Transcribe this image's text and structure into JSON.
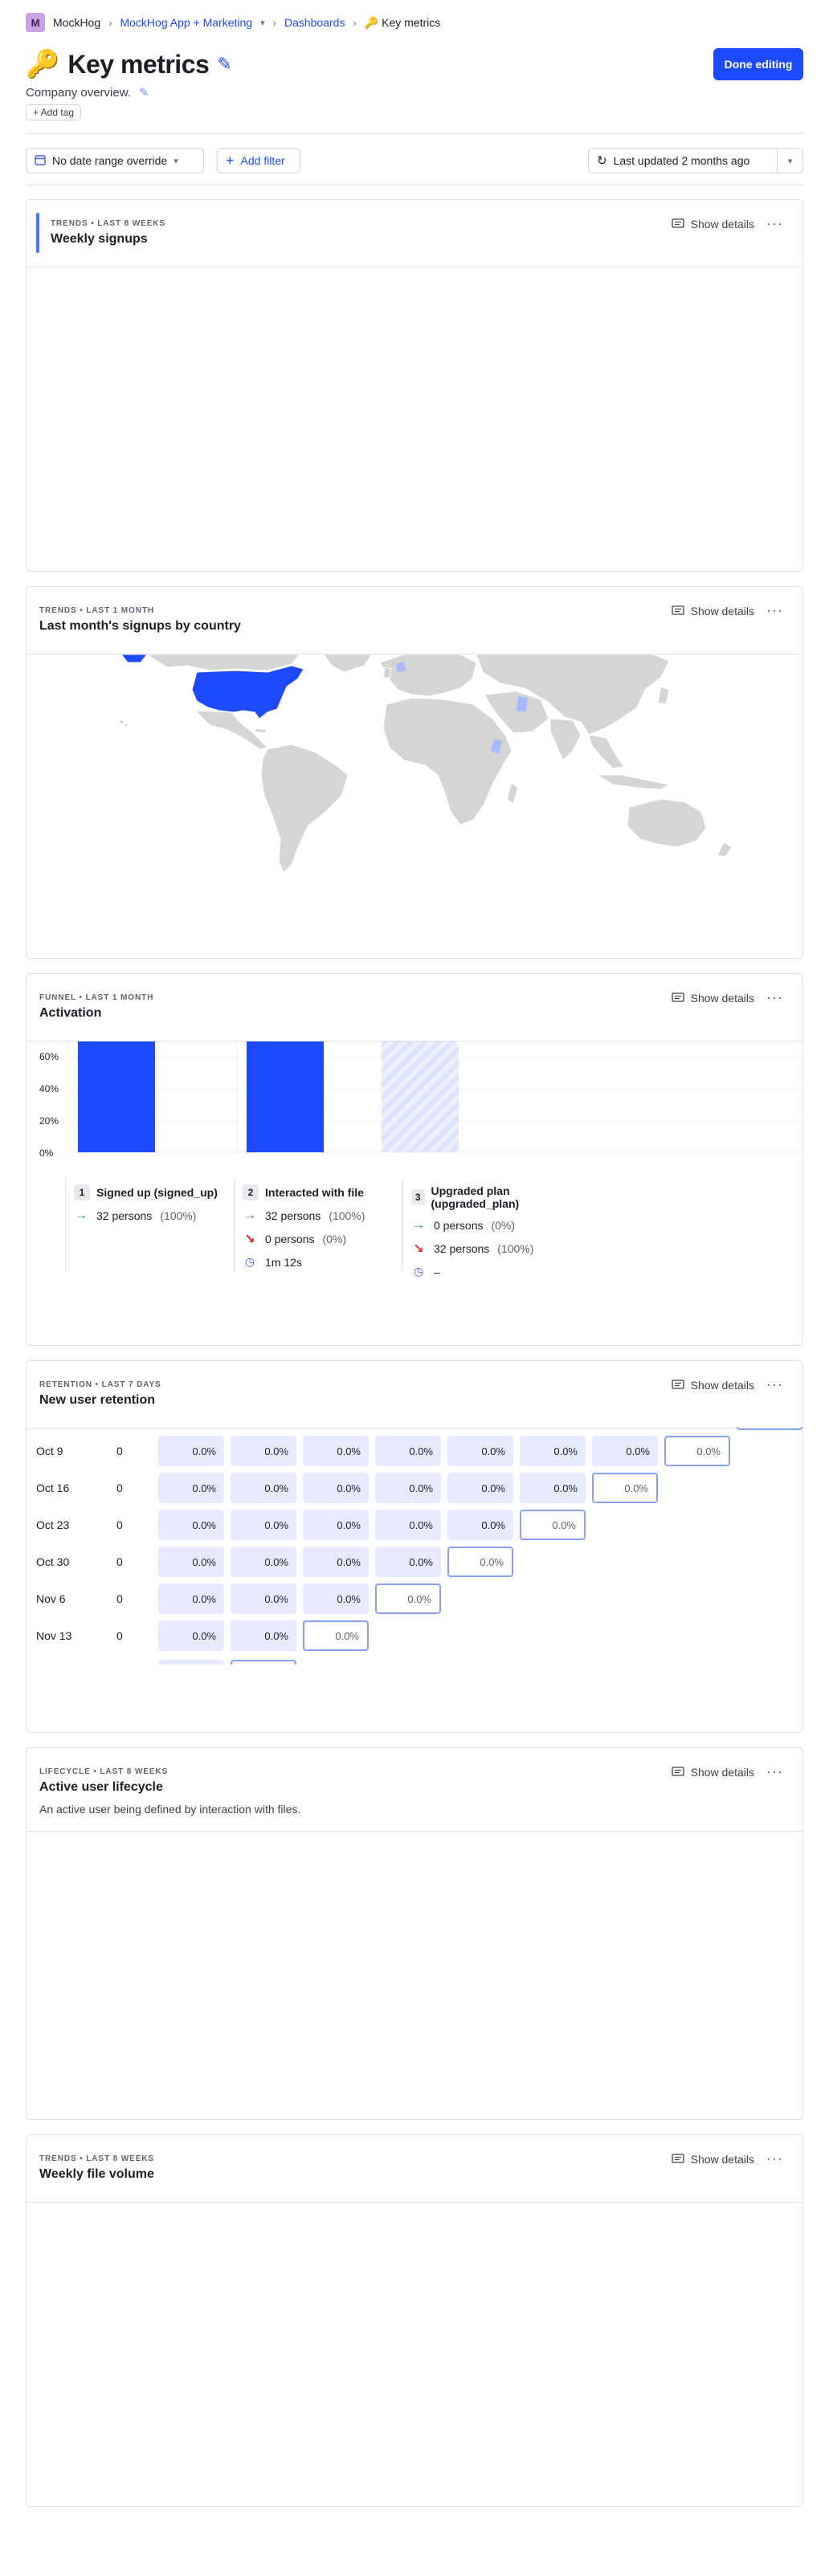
{
  "breadcrumb": {
    "org_initial": "M",
    "org": "MockHog",
    "project": "MockHog App + Marketing",
    "section": "Dashboards",
    "current": "Key metrics",
    "current_emoji": "🔑"
  },
  "header": {
    "emoji": "🔑",
    "title": "Key metrics",
    "description": "Company overview.",
    "add_tag": "+ Add tag",
    "done_button": "Done editing"
  },
  "filters": {
    "date_range": "No date range override",
    "add_filter": "Add filter",
    "last_updated": "Last updated 2 months ago"
  },
  "cards": [
    {
      "kicker": "TRENDS • LAST 8 WEEKS",
      "title": "Weekly signups",
      "show_details": "Show details"
    },
    {
      "kicker": "TRENDS • LAST 1 MONTH",
      "title": "Last month's signups by country",
      "show_details": "Show details"
    },
    {
      "kicker": "FUNNEL • LAST 1 MONTH",
      "title": "Activation",
      "show_details": "Show details"
    },
    {
      "kicker": "RETENTION • LAST 7 DAYS",
      "title": "New user retention",
      "show_details": "Show details"
    },
    {
      "kicker": "LIFECYCLE • LAST 8 WEEKS",
      "title": "Active user lifecycle",
      "subtitle": "An active user being defined by interaction with files.",
      "show_details": "Show details"
    },
    {
      "kicker": "TRENDS • LAST 8 WEEKS",
      "title": "Weekly file volume",
      "show_details": "Show details"
    }
  ],
  "colors": {
    "accent": "#1d4aff",
    "bar": "#1d4aff",
    "map_highlight": "#1d4aff",
    "map_land": "#d5d5d5",
    "retention_cell": "#e8ebff"
  },
  "map": {
    "highlighted_country": "United States"
  },
  "chart_data": {
    "type": "bar",
    "title": "Activation",
    "yticks": [
      "60%",
      "40%",
      "20%",
      "0%"
    ],
    "categories": [
      "Signed up (signed_up)",
      "Interacted with file",
      "Upgraded plan (upgraded_plan)"
    ],
    "values": [
      100,
      100,
      0
    ]
  },
  "funnel_steps": [
    {
      "num": "1",
      "name": "Signed up (signed_up)",
      "converted": "32 persons",
      "converted_pct": "(100%)"
    },
    {
      "num": "2",
      "name": "Interacted with file",
      "converted": "32 persons",
      "converted_pct": "(100%)",
      "dropped": "0 persons",
      "dropped_pct": "(0%)",
      "time": "1m 12s"
    },
    {
      "num": "3",
      "name": "Upgraded plan (upgraded_plan)",
      "converted": "0 persons",
      "converted_pct": "(0%)",
      "dropped": "32 persons",
      "dropped_pct": "(100%)",
      "time": "–"
    }
  ],
  "retention": {
    "rows": [
      {
        "date": "Oct 9",
        "count": "0",
        "cells": [
          "0.0%",
          "0.0%",
          "0.0%",
          "0.0%",
          "0.0%",
          "0.0%",
          "0.0%",
          "0.0%"
        ]
      },
      {
        "date": "Oct 16",
        "count": "0",
        "cells": [
          "0.0%",
          "0.0%",
          "0.0%",
          "0.0%",
          "0.0%",
          "0.0%",
          "0.0%"
        ]
      },
      {
        "date": "Oct 23",
        "count": "0",
        "cells": [
          "0.0%",
          "0.0%",
          "0.0%",
          "0.0%",
          "0.0%",
          "0.0%"
        ]
      },
      {
        "date": "Oct 30",
        "count": "0",
        "cells": [
          "0.0%",
          "0.0%",
          "0.0%",
          "0.0%",
          "0.0%"
        ]
      },
      {
        "date": "Nov 6",
        "count": "0",
        "cells": [
          "0.0%",
          "0.0%",
          "0.0%",
          "0.0%"
        ]
      },
      {
        "date": "Nov 13",
        "count": "0",
        "cells": [
          "0.0%",
          "0.0%",
          "0.0%"
        ]
      }
    ]
  }
}
